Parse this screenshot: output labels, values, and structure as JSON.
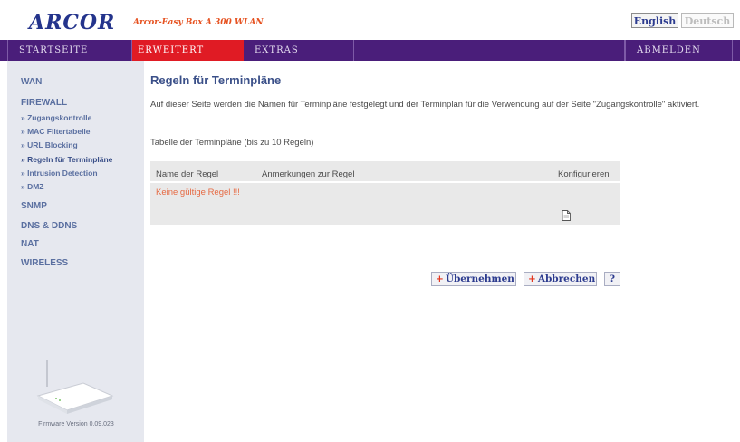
{
  "header": {
    "logo": "ARCOR",
    "tagline": "Arcor-Easy Box A 300 WLAN",
    "lang_english": "English",
    "lang_deutsch": "Deutsch"
  },
  "nav": {
    "startseite": "STARTSEITE",
    "erweitert": "ERWEITERT",
    "extras": "EXTRAS",
    "abmelden": "ABMELDEN"
  },
  "sidebar": {
    "wan": "WAN",
    "firewall": "FIREWALL",
    "firewall_items": [
      "» Zugangskontrolle",
      "» MAC Filtertabelle",
      "» URL Blocking",
      "» Regeln für Terminpläne",
      "» Intrusion Detection",
      "» DMZ"
    ],
    "snmp": "SNMP",
    "dns_ddns": "DNS & DDNS",
    "nat": "NAT",
    "wireless": "WIRELESS",
    "firmware": "Firmware Version 0.09.023"
  },
  "main": {
    "title": "Regeln für Terminpläne",
    "description": "Auf dieser Seite werden die Namen für Terminpläne festgelegt und der Terminplan für die Verwendung auf der Seite \"Zugangskontrolle\" aktiviert.",
    "table_caption": "Tabelle der Terminpläne (bis zu 10 Regeln)",
    "table": {
      "col_name": "Name der Regel",
      "col_note": "Anmerkungen zur Regel",
      "col_config": "Konfigurieren",
      "empty_message": "Keine gültige Regel !!!"
    },
    "buttons": {
      "plus": "+",
      "apply": "Übernehmen",
      "cancel": "Abbrechen",
      "help": "?"
    }
  },
  "colors": {
    "nav_bg": "#4a1e7a",
    "nav_active": "#e01b24",
    "link_blue": "#3a4f88",
    "warning_orange": "#e66a43"
  }
}
